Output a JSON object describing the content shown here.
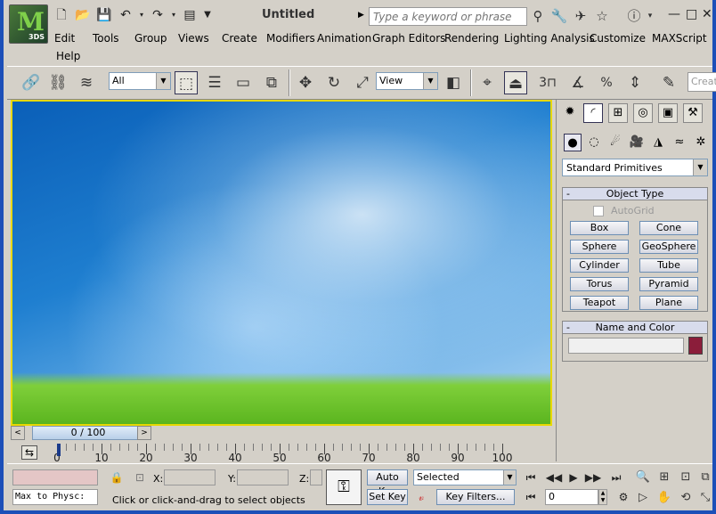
{
  "app": {
    "title": "Untitled",
    "logo_text": "3DS"
  },
  "search": {
    "placeholder": "Type a keyword or phrase"
  },
  "menu": {
    "items": [
      "Edit",
      "Tools",
      "Group",
      "Views",
      "Create",
      "Modifiers",
      "Animation",
      "Graph Editors",
      "Rendering",
      "Lighting Analysis",
      "Customize",
      "MAXScript",
      "Help"
    ]
  },
  "toolbar": {
    "selection_filter": "All",
    "reference_coord": "View",
    "snap_value": "3",
    "create_selection_placeholder": "Create"
  },
  "viewport": {
    "frame_counter": "0 / 100"
  },
  "timeline": {
    "labels": [
      "0",
      "10",
      "20",
      "30",
      "40",
      "50",
      "60",
      "70",
      "80",
      "90",
      "100"
    ]
  },
  "command_panel": {
    "category": "Standard Primitives",
    "object_type": {
      "header": "Object Type",
      "autogrid_label": "AutoGrid",
      "buttons": [
        "Box",
        "Cone",
        "Sphere",
        "GeoSphere",
        "Cylinder",
        "Tube",
        "Torus",
        "Pyramid",
        "Teapot",
        "Plane"
      ]
    },
    "name_and_color": {
      "header": "Name and Color",
      "color": "#8b1d3a"
    }
  },
  "statusbar": {
    "script_text": "Max to Physc:",
    "x_label": "X:",
    "y_label": "Y:",
    "z_label": "Z:",
    "prompt": "Click or click-and-drag to select objects",
    "auto_key": "Auto Key",
    "set_key": "Set Key",
    "selected": "Selected",
    "key_filters": "Key Filters...",
    "current_frame": "0"
  }
}
